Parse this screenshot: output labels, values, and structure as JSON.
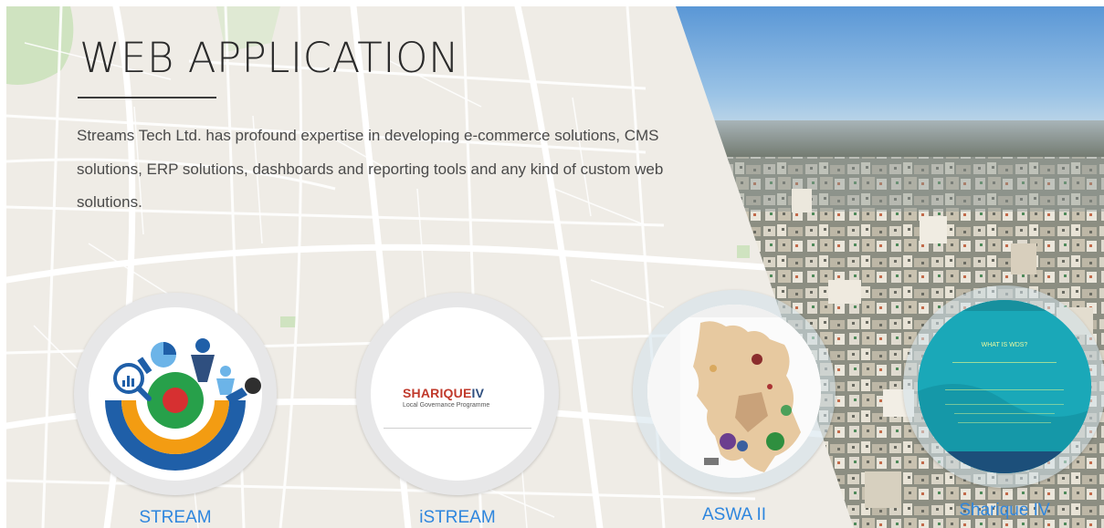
{
  "section": {
    "title": "WEB APPLICATION",
    "description": "Streams Tech Ltd. has profound expertise in developing e-commerce solutions, CMS solutions, ERP solutions, dashboards and reporting tools and any kind of custom web solutions."
  },
  "apps": [
    {
      "label": "STREAM"
    },
    {
      "label": "iSTREAM",
      "logo_main": "SHARIQUE",
      "logo_roman": "IV",
      "logo_sub": "Local Governance Programme"
    },
    {
      "label": "ASWA II"
    },
    {
      "label": "Sharique IV",
      "thumb_heading": "WHAT IS WDS?"
    }
  ],
  "colors": {
    "link": "#2e86de",
    "title": "#2b2b2b",
    "map_bg": "#efece6",
    "sky": "#7fb1de",
    "teal_thumb": "#1aa8b8"
  }
}
